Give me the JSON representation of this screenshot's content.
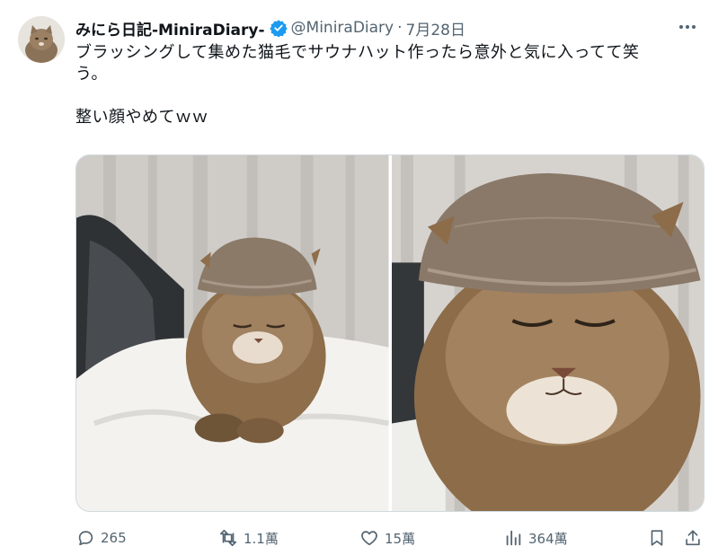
{
  "user": {
    "display_name": "みにら日記-MiniraDiary-",
    "handle": "@MiniraDiary",
    "separator": "·",
    "date": "7月28日"
  },
  "tweet": {
    "line1": "ブラッシングして集めた猫毛でサウナハット作ったら意外と気に入ってて笑",
    "line2": "う。",
    "line3": "整い顔やめてｗｗ"
  },
  "media": {
    "photo1_icon": "photo-cat-with-fur-hat",
    "photo2_icon": "photo-cat-closeup"
  },
  "stats": {
    "replies": "265",
    "retweets": "1.1萬",
    "likes": "15萬",
    "views": "364萬"
  },
  "colors": {
    "text": "#0f1419",
    "secondary": "#536471",
    "verified": "#1d9bf0"
  }
}
